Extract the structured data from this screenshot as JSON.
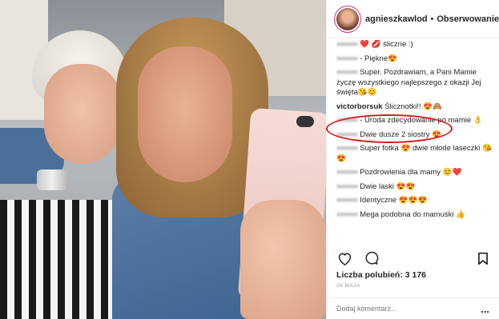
{
  "post": {
    "username": "agnieszkawlodarcz...",
    "separator": "•",
    "follow_label": "Obserwowanie"
  },
  "comments": [
    {
      "user": "••••••••",
      "text": "❤️ 💋 śliczne :)",
      "blurred": true
    },
    {
      "user": "••••••••",
      "text": "- Piękne😍",
      "blurred": true
    },
    {
      "user": "••••••••",
      "text": "Super. Pozdrawiam, a Pani Mamie życzę wszystkiego najlepszego z okazji Jej święta😘😊",
      "blurred": true
    },
    {
      "user": "victorborsuk",
      "text": "Ślicznotki!! 😍🙈",
      "blurred": false
    },
    {
      "user": "••••••••",
      "text": "- Uroda zdecydowanie po mamie 👌",
      "blurred": true
    },
    {
      "user": "••••••••",
      "text": "Dwie dusze 2 siostry 😍",
      "blurred": true
    },
    {
      "user": "••••••••",
      "text": "Super fotka 😍 dwie młode laseczki 😘😍",
      "blurred": true
    },
    {
      "user": "••••••••",
      "text": "Pozdrowienia dla mamy 😊❤️",
      "blurred": true
    },
    {
      "user": "••••••••",
      "text": "Dwie laski 😍😍",
      "blurred": true
    },
    {
      "user": "••••••••",
      "text": "Identyczne 😍😍😍",
      "blurred": true
    },
    {
      "user": "••••••••",
      "text": "Mega podobna do mamuśki 👍",
      "blurred": true
    }
  ],
  "likes_text": "Liczba polubień: 3 176",
  "date": "26 MAJA",
  "add_comment_placeholder": "Dodaj komentarz...",
  "more_label": "..."
}
